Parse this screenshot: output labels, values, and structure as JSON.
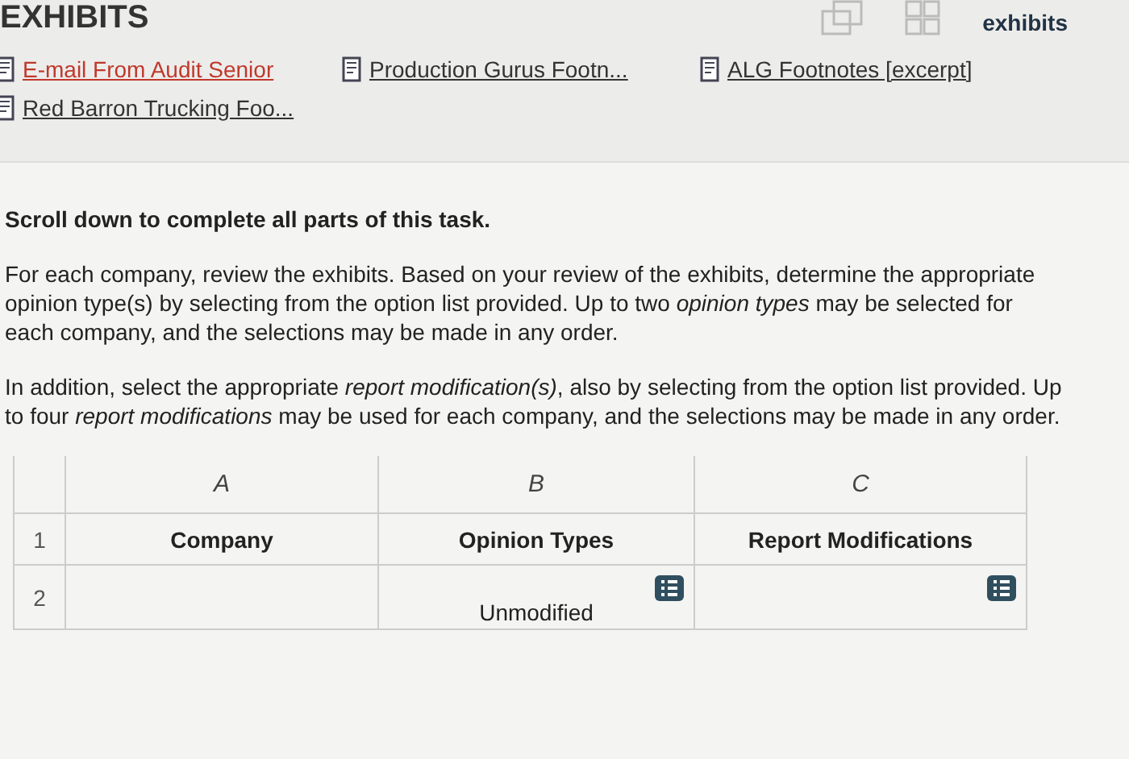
{
  "exhibits_panel": {
    "title": "EXHIBITS",
    "close_label": "exhibits",
    "links": [
      {
        "label": "E-mail From Audit Senior",
        "selected": true
      },
      {
        "label": "Production Gurus Footn...",
        "selected": false
      },
      {
        "label": "ALG Footnotes [excerpt]",
        "selected": false
      },
      {
        "label": "Red Barron Trucking Foo...",
        "selected": false
      }
    ]
  },
  "task": {
    "scroll_note": "Scroll down to complete all parts of this task.",
    "paragraphs": [
      "For each company, review the exhibits. Based on your review of the exhibits, determine the appropriate opinion type(s) by selecting from the option list provided. Up to two *opinion types* may be selected for each company, and the selections may be made in any order.",
      "In addition, select the appropriate *report modification(s)*, also by selecting from the option list provided. Up to four *report modifications* may be used for each company, and the selections may be made in any order."
    ]
  },
  "table": {
    "columns": [
      "A",
      "B",
      "C"
    ],
    "rows": [
      {
        "number": "1",
        "cells": [
          {
            "kind": "header",
            "text": "Company"
          },
          {
            "kind": "header",
            "text": "Opinion Types"
          },
          {
            "kind": "header",
            "text": "Report Modifications"
          }
        ]
      },
      {
        "number": "2",
        "cells": [
          {
            "kind": "text",
            "text": ""
          },
          {
            "kind": "select",
            "text": "Unmodified"
          },
          {
            "kind": "select",
            "text": ""
          }
        ]
      }
    ]
  }
}
